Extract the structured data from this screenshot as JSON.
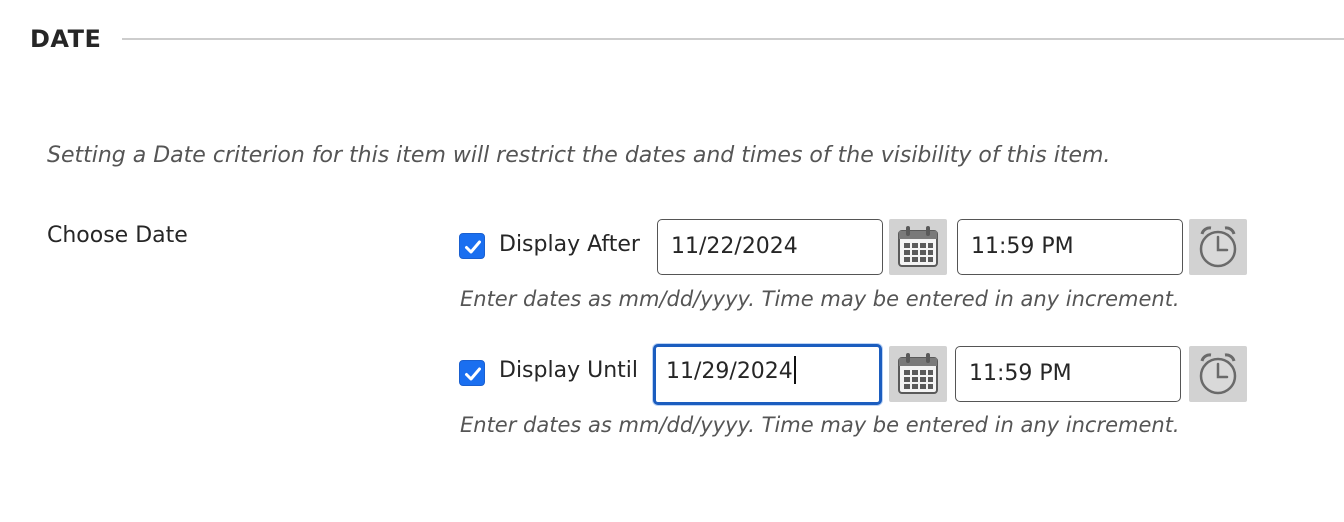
{
  "section": {
    "title": "DATE"
  },
  "instructions": "Setting a Date criterion for this item will restrict the dates and times of the visibility of this item.",
  "field_label": "Choose Date",
  "display_after": {
    "checked": true,
    "label": "Display After",
    "date_value": "11/22/2024",
    "time_value": "11:59 PM",
    "help_text": "Enter dates as mm/dd/yyyy. Time may be entered in any increment.",
    "calendar_icon": "calendar-icon",
    "clock_icon": "clock-icon"
  },
  "display_until": {
    "checked": true,
    "label": "Display Until",
    "date_value": "11/29/2024",
    "time_value": "11:59 PM",
    "help_text": "Enter dates as mm/dd/yyyy. Time may be entered in any increment.",
    "calendar_icon": "calendar-icon",
    "clock_icon": "clock-icon"
  },
  "colors": {
    "checkbox": "#1a6ff0",
    "focus_border": "#1b5dbf",
    "icon_button_bg": "#d2d2d2"
  }
}
